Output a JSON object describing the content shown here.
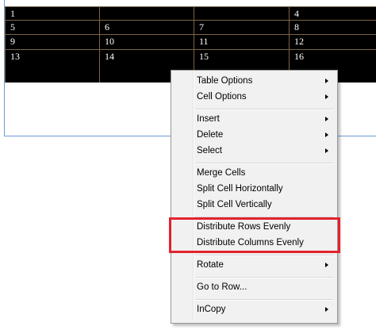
{
  "table": {
    "rows": [
      [
        "1",
        "",
        "",
        "4"
      ],
      [
        "5",
        "6",
        "7",
        "8"
      ],
      [
        "9",
        "10",
        "11",
        "12"
      ],
      [
        "13",
        "14",
        "15",
        "16"
      ]
    ]
  },
  "context_menu": {
    "table_options": "Table Options",
    "cell_options": "Cell Options",
    "insert": "Insert",
    "delete": "Delete",
    "select": "Select",
    "merge_cells": "Merge Cells",
    "split_horizontal": "Split Cell Horizontally",
    "split_vertical": "Split Cell Vertically",
    "distribute_rows": "Distribute Rows Evenly",
    "distribute_columns": "Distribute Columns Evenly",
    "rotate": "Rotate",
    "go_to_row": "Go to Row...",
    "incopy": "InCopy"
  },
  "colors": {
    "table_background": "#000000",
    "table_border": "#7a6543",
    "menu_background": "#f1f1f1",
    "highlight_box": "#e3222d",
    "frame_edge": "#6f9ad8"
  }
}
